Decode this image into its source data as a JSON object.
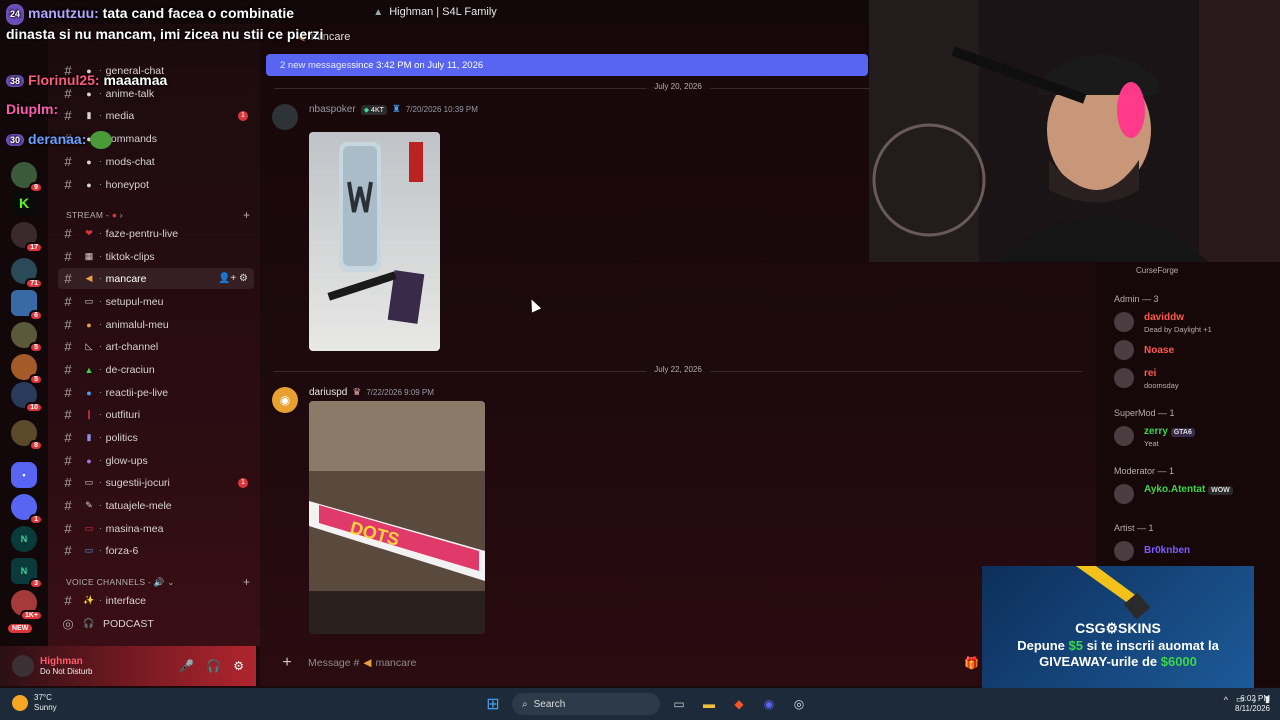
{
  "window": {
    "title": "Highman | S4L Family"
  },
  "rail": {
    "badges": [
      "9",
      "17",
      "71",
      "6",
      "5",
      "10",
      "8",
      "1",
      "3",
      "1K+"
    ],
    "new_label": "NEW"
  },
  "sidebar": {
    "channels_top": [
      {
        "name": "general-chat",
        "emoji": "●"
      },
      {
        "name": "anime-talk",
        "emoji": "●"
      },
      {
        "name": "media",
        "emoji": "▮",
        "unread": "1"
      },
      {
        "name": "commands",
        "emoji": "●"
      },
      {
        "name": "mods-chat",
        "emoji": "●"
      },
      {
        "name": "honeypot",
        "emoji": "●"
      }
    ],
    "stream_category": "STREAM - ",
    "stream_channels": [
      {
        "name": "faze-pentru-live",
        "emoji": "❤"
      },
      {
        "name": "tiktok-clips",
        "emoji": "▦"
      },
      {
        "name": "mancare",
        "emoji": "◀",
        "active": true
      },
      {
        "name": "setupul-meu",
        "emoji": "▭"
      },
      {
        "name": "animalul-meu",
        "emoji": "●"
      },
      {
        "name": "art-channel",
        "emoji": "◺"
      },
      {
        "name": "de-craciun",
        "emoji": "▲"
      },
      {
        "name": "reactii-pe-live",
        "emoji": "●"
      },
      {
        "name": "outfituri",
        "emoji": "❙"
      },
      {
        "name": "politics",
        "emoji": "▮"
      },
      {
        "name": "glow-ups",
        "emoji": "●"
      },
      {
        "name": "sugestii-jocuri",
        "emoji": "▭",
        "unread": "1"
      },
      {
        "name": "tatuajele-mele",
        "emoji": "✎"
      },
      {
        "name": "masina-mea",
        "emoji": "▭"
      },
      {
        "name": "forza-6",
        "emoji": "▭"
      }
    ],
    "voice_category": "VOICE CHANNELS - ",
    "voice_channels": [
      {
        "name": "interface",
        "emoji": "✨"
      },
      {
        "name": "PODCAST",
        "emoji": ""
      }
    ]
  },
  "user": {
    "name": "Highman",
    "status": "Do Not Disturb"
  },
  "chat": {
    "channel": "mancare",
    "new_messages": "2 new messages",
    "new_messages_since": " since 3:42 PM on July 11, 2026",
    "date1": "July 20, 2026",
    "msg1": {
      "author": "nbaspoker",
      "tag": "4KT",
      "time": "7/20/2026 10:39 PM"
    },
    "date2": "July 22, 2026",
    "msg2": {
      "author": "dariuspd",
      "time": "7/22/2026 9:09 PM"
    },
    "placeholder": "Message #",
    "placeholder_channel": "mancare"
  },
  "members": {
    "top_activity": "CurseForge",
    "admin_role": "Admin — 3",
    "admins": [
      {
        "name": "daviddw",
        "sub": "Dead by Daylight +1",
        "color": "#ff5a4a"
      },
      {
        "name": "Noase",
        "sub": "",
        "color": "#ff5a4a"
      },
      {
        "name": "rei",
        "sub": "doomsday",
        "color": "#ff5a4a"
      }
    ],
    "supermod_role": "SuperMod — 1",
    "supermods": [
      {
        "name": "zerry",
        "tag": "GTA6",
        "sub": "Yeat",
        "color": "#3dd64a"
      }
    ],
    "moderator_role": "Moderator — 1",
    "moderators": [
      {
        "name": "Ayko.Atentat",
        "tag": "WOW",
        "sub": "",
        "color": "#3dd64a"
      }
    ],
    "artist_role": "Artist — 1",
    "artists": [
      {
        "name": "Br0knben",
        "color": "#7c5cff"
      }
    ]
  },
  "overlay_chat": [
    {
      "level": "24",
      "user": "manutzuu:",
      "text": "tata cand facea o combinatie dinasta si nu mancam, imi zicea nu stii ce pierzi"
    },
    {
      "level": "38",
      "user": "Florinul25:",
      "text": "maaamaa"
    },
    {
      "level": "",
      "user": "Diuplm:",
      "text": ""
    },
    {
      "level": "30",
      "user": "deranaa:",
      "text": ""
    }
  ],
  "ad": {
    "brand": "CSG⚙SKINS",
    "line1_a": "Depune ",
    "line1_amount": "$5",
    "line1_b": " si te inscrii auomat la",
    "line2_a": "GIVEAWAY-urile de ",
    "line2_amount": "$6000"
  },
  "taskbar": {
    "weather_temp": "37°C",
    "weather_desc": "Sunny",
    "search": "Search",
    "time": "6:02 PM",
    "date": "8/11/2026"
  }
}
